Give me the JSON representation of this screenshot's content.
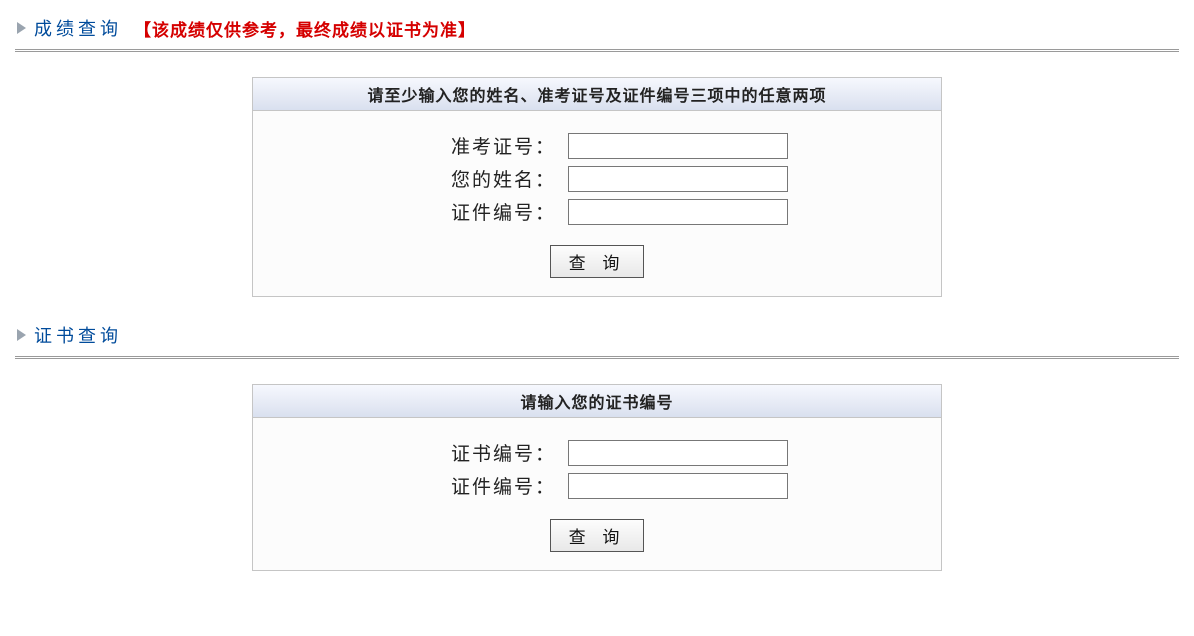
{
  "scoreSection": {
    "title": "成绩查询",
    "warning": "【该成绩仅供参考，最终成绩以证书为准】",
    "panelHeader": "请至少输入您的姓名、准考证号及证件编号三项中的任意两项",
    "fields": {
      "ticketLabel": "准考证号：",
      "ticketValue": "",
      "nameLabel": "您的姓名：",
      "nameValue": "",
      "idLabel": "证件编号：",
      "idValue": ""
    },
    "buttonLabel": "查 询"
  },
  "certSection": {
    "title": "证书查询",
    "panelHeader": "请输入您的证书编号",
    "fields": {
      "certLabel1": "证书编号：",
      "certValue1": "",
      "certLabel2": "证件编号：",
      "certValue2": ""
    },
    "buttonLabel": "查 询"
  }
}
